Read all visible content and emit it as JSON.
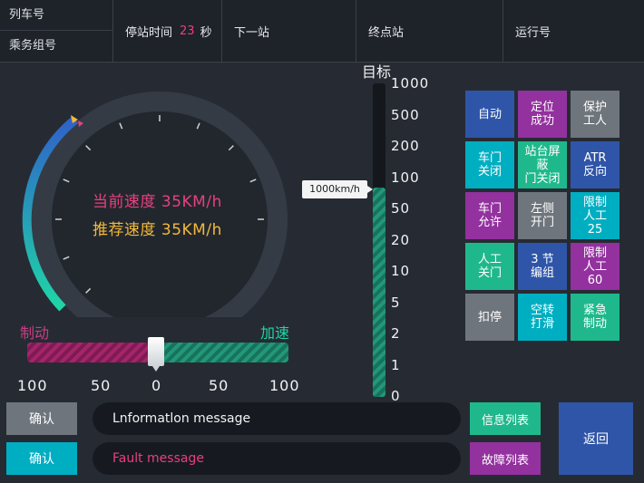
{
  "header": {
    "train_number_label": "列车号",
    "crew_number_label": "乘务组号",
    "dwell_label": "停站时间",
    "dwell_value": "23",
    "dwell_unit": "秒",
    "next_station_label": "下一站",
    "terminal_label": "终点站",
    "service_number_label": "运行号"
  },
  "speedometer": {
    "current_speed": "当前速度 35KM/h",
    "recommended_speed": "推荐速度 35KM/h"
  },
  "slider": {
    "brake_label": "制动",
    "accel_label": "加速",
    "position_percent": 50,
    "scale": [
      "100",
      "50",
      "0",
      "50",
      "100"
    ]
  },
  "target": {
    "title": "目标",
    "ticks": [
      "1000",
      "500",
      "200",
      "100",
      "50",
      "20",
      "10",
      "5",
      "2",
      "1",
      "0"
    ],
    "tooltip": "1000km/h",
    "fill_fraction": 0.67
  },
  "buttons": [
    {
      "label": "自动",
      "color": "#2f55a8"
    },
    {
      "label": "定位\n成功",
      "color": "#93319e"
    },
    {
      "label": "保护\n工人",
      "color": "#6f757c"
    },
    {
      "label": "车门\n关闭",
      "color": "#00aec2"
    },
    {
      "label": "站台屏蔽\n门关闭",
      "color": "#1fb88c"
    },
    {
      "label": "ATR\n反向",
      "color": "#2f55a8"
    },
    {
      "label": "车门\n允许",
      "color": "#93319e"
    },
    {
      "label": "左侧\n开门",
      "color": "#6f757c"
    },
    {
      "label": "限制\n人工\n25",
      "color": "#00aec2"
    },
    {
      "label": "人工\n关门",
      "color": "#1fb88c"
    },
    {
      "label": "3 节\n编组",
      "color": "#2f55a8"
    },
    {
      "label": "限制\n人工\n60",
      "color": "#93319e"
    },
    {
      "label": "扣停",
      "color": "#6f757c"
    },
    {
      "label": "空转\n打滑",
      "color": "#00aec2"
    },
    {
      "label": "紧急\n制动",
      "color": "#1fb88c"
    }
  ],
  "bottom": {
    "confirm_1": "确认",
    "confirm_2": "确认",
    "info_message": "Lnformatlon message",
    "fault_message": "Fault message",
    "info_list": "信息列表",
    "fault_list": "故障列表",
    "back": "返回"
  },
  "colors": {
    "accent_teal": "#22977a",
    "accent_magenta": "#a4256b",
    "fault_text": "#e8407f",
    "speed_current": "#e8407f",
    "speed_recommended": "#f2b93b"
  }
}
